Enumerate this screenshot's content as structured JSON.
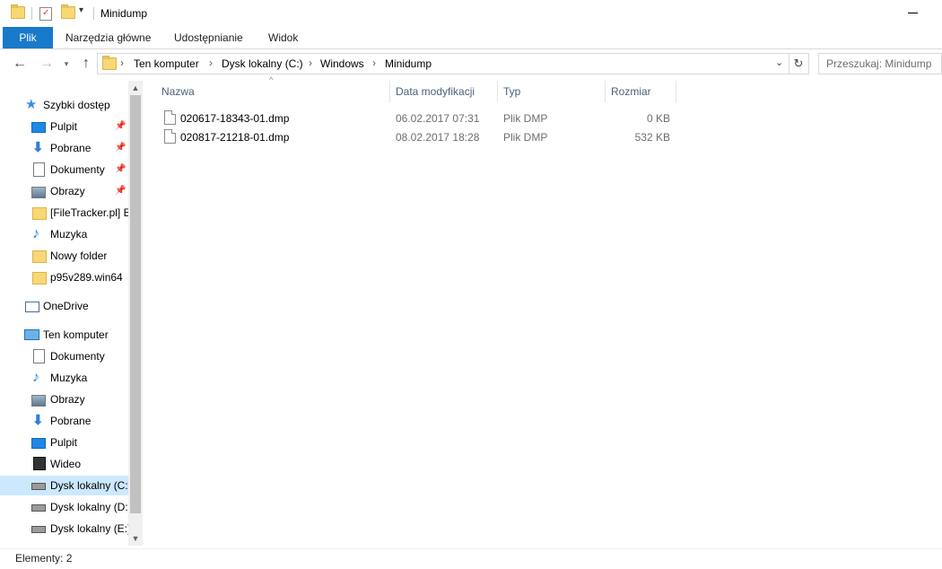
{
  "window": {
    "title": "Minidump"
  },
  "ribbon": {
    "tabs": [
      "Plik",
      "Narzędzia główne",
      "Udostępnianie",
      "Widok"
    ]
  },
  "address": {
    "crumbs": [
      "Ten komputer",
      "Dysk lokalny (C:)",
      "Windows",
      "Minidump"
    ]
  },
  "search": {
    "placeholder": "Przeszukaj: Minidump"
  },
  "navpane": {
    "quick_access": "Szybki dostęp",
    "items": [
      {
        "label": "Pulpit",
        "icon": "desktop-icon",
        "pinned": true
      },
      {
        "label": "Pobrane",
        "icon": "download-icon",
        "pinned": true
      },
      {
        "label": "Dokumenty",
        "icon": "documents-icon",
        "pinned": true
      },
      {
        "label": "Obrazy",
        "icon": "pictures-icon",
        "pinned": true
      },
      {
        "label": "[FileTracker.pl]  E",
        "icon": "folder-icon",
        "pinned": false
      },
      {
        "label": "Muzyka",
        "icon": "music-icon",
        "pinned": false
      },
      {
        "label": "Nowy folder",
        "icon": "folder-icon",
        "pinned": false
      },
      {
        "label": "p95v289.win64",
        "icon": "folder-icon",
        "pinned": false
      }
    ],
    "onedrive": "OneDrive",
    "this_pc": "Ten komputer",
    "pc_items": [
      {
        "label": "Dokumenty",
        "icon": "documents-icon"
      },
      {
        "label": "Muzyka",
        "icon": "music-icon"
      },
      {
        "label": "Obrazy",
        "icon": "pictures-icon"
      },
      {
        "label": "Pobrane",
        "icon": "download-icon"
      },
      {
        "label": "Pulpit",
        "icon": "desktop-icon"
      },
      {
        "label": "Wideo",
        "icon": "video-icon"
      },
      {
        "label": "Dysk lokalny (C:)",
        "icon": "drive-icon",
        "selected": true
      },
      {
        "label": "Dysk lokalny (D:)",
        "icon": "drive-icon"
      },
      {
        "label": "Dysk lokalny (E:)",
        "icon": "drive-icon"
      }
    ]
  },
  "list": {
    "columns": [
      "Nazwa",
      "Data modyfikacji",
      "Typ",
      "Rozmiar"
    ],
    "rows": [
      {
        "name": "020617-18343-01.dmp",
        "date": "06.02.2017 07:31",
        "type": "Plik DMP",
        "size": "0 KB"
      },
      {
        "name": "020817-21218-01.dmp",
        "date": "08.02.2017 18:28",
        "type": "Plik DMP",
        "size": "532 KB"
      }
    ]
  },
  "status": {
    "text": "Elementy: 2"
  },
  "colors": {
    "accent": "#1979ca",
    "selection": "#cce8ff",
    "header_text": "#4c607a"
  }
}
